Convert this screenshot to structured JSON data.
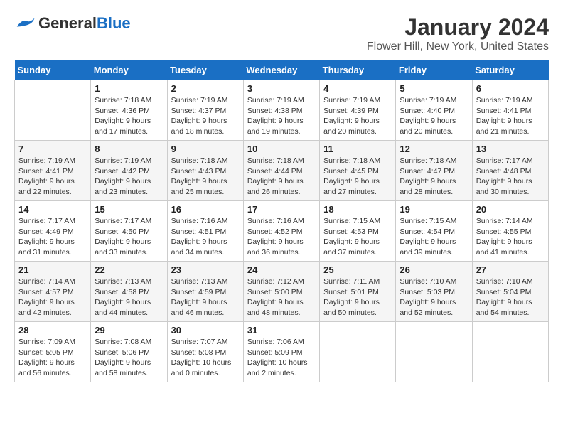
{
  "header": {
    "logo": {
      "general": "General",
      "blue": "Blue"
    },
    "title": "January 2024",
    "subtitle": "Flower Hill, New York, United States"
  },
  "calendar": {
    "days_of_week": [
      "Sunday",
      "Monday",
      "Tuesday",
      "Wednesday",
      "Thursday",
      "Friday",
      "Saturday"
    ],
    "weeks": [
      [
        {
          "day": "",
          "info": ""
        },
        {
          "day": "1",
          "info": "Sunrise: 7:18 AM\nSunset: 4:36 PM\nDaylight: 9 hours\nand 17 minutes."
        },
        {
          "day": "2",
          "info": "Sunrise: 7:19 AM\nSunset: 4:37 PM\nDaylight: 9 hours\nand 18 minutes."
        },
        {
          "day": "3",
          "info": "Sunrise: 7:19 AM\nSunset: 4:38 PM\nDaylight: 9 hours\nand 19 minutes."
        },
        {
          "day": "4",
          "info": "Sunrise: 7:19 AM\nSunset: 4:39 PM\nDaylight: 9 hours\nand 20 minutes."
        },
        {
          "day": "5",
          "info": "Sunrise: 7:19 AM\nSunset: 4:40 PM\nDaylight: 9 hours\nand 20 minutes."
        },
        {
          "day": "6",
          "info": "Sunrise: 7:19 AM\nSunset: 4:41 PM\nDaylight: 9 hours\nand 21 minutes."
        }
      ],
      [
        {
          "day": "7",
          "info": "Sunrise: 7:19 AM\nSunset: 4:41 PM\nDaylight: 9 hours\nand 22 minutes."
        },
        {
          "day": "8",
          "info": "Sunrise: 7:19 AM\nSunset: 4:42 PM\nDaylight: 9 hours\nand 23 minutes."
        },
        {
          "day": "9",
          "info": "Sunrise: 7:18 AM\nSunset: 4:43 PM\nDaylight: 9 hours\nand 25 minutes."
        },
        {
          "day": "10",
          "info": "Sunrise: 7:18 AM\nSunset: 4:44 PM\nDaylight: 9 hours\nand 26 minutes."
        },
        {
          "day": "11",
          "info": "Sunrise: 7:18 AM\nSunset: 4:45 PM\nDaylight: 9 hours\nand 27 minutes."
        },
        {
          "day": "12",
          "info": "Sunrise: 7:18 AM\nSunset: 4:47 PM\nDaylight: 9 hours\nand 28 minutes."
        },
        {
          "day": "13",
          "info": "Sunrise: 7:17 AM\nSunset: 4:48 PM\nDaylight: 9 hours\nand 30 minutes."
        }
      ],
      [
        {
          "day": "14",
          "info": "Sunrise: 7:17 AM\nSunset: 4:49 PM\nDaylight: 9 hours\nand 31 minutes."
        },
        {
          "day": "15",
          "info": "Sunrise: 7:17 AM\nSunset: 4:50 PM\nDaylight: 9 hours\nand 33 minutes."
        },
        {
          "day": "16",
          "info": "Sunrise: 7:16 AM\nSunset: 4:51 PM\nDaylight: 9 hours\nand 34 minutes."
        },
        {
          "day": "17",
          "info": "Sunrise: 7:16 AM\nSunset: 4:52 PM\nDaylight: 9 hours\nand 36 minutes."
        },
        {
          "day": "18",
          "info": "Sunrise: 7:15 AM\nSunset: 4:53 PM\nDaylight: 9 hours\nand 37 minutes."
        },
        {
          "day": "19",
          "info": "Sunrise: 7:15 AM\nSunset: 4:54 PM\nDaylight: 9 hours\nand 39 minutes."
        },
        {
          "day": "20",
          "info": "Sunrise: 7:14 AM\nSunset: 4:55 PM\nDaylight: 9 hours\nand 41 minutes."
        }
      ],
      [
        {
          "day": "21",
          "info": "Sunrise: 7:14 AM\nSunset: 4:57 PM\nDaylight: 9 hours\nand 42 minutes."
        },
        {
          "day": "22",
          "info": "Sunrise: 7:13 AM\nSunset: 4:58 PM\nDaylight: 9 hours\nand 44 minutes."
        },
        {
          "day": "23",
          "info": "Sunrise: 7:13 AM\nSunset: 4:59 PM\nDaylight: 9 hours\nand 46 minutes."
        },
        {
          "day": "24",
          "info": "Sunrise: 7:12 AM\nSunset: 5:00 PM\nDaylight: 9 hours\nand 48 minutes."
        },
        {
          "day": "25",
          "info": "Sunrise: 7:11 AM\nSunset: 5:01 PM\nDaylight: 9 hours\nand 50 minutes."
        },
        {
          "day": "26",
          "info": "Sunrise: 7:10 AM\nSunset: 5:03 PM\nDaylight: 9 hours\nand 52 minutes."
        },
        {
          "day": "27",
          "info": "Sunrise: 7:10 AM\nSunset: 5:04 PM\nDaylight: 9 hours\nand 54 minutes."
        }
      ],
      [
        {
          "day": "28",
          "info": "Sunrise: 7:09 AM\nSunset: 5:05 PM\nDaylight: 9 hours\nand 56 minutes."
        },
        {
          "day": "29",
          "info": "Sunrise: 7:08 AM\nSunset: 5:06 PM\nDaylight: 9 hours\nand 58 minutes."
        },
        {
          "day": "30",
          "info": "Sunrise: 7:07 AM\nSunset: 5:08 PM\nDaylight: 10 hours\nand 0 minutes."
        },
        {
          "day": "31",
          "info": "Sunrise: 7:06 AM\nSunset: 5:09 PM\nDaylight: 10 hours\nand 2 minutes."
        },
        {
          "day": "",
          "info": ""
        },
        {
          "day": "",
          "info": ""
        },
        {
          "day": "",
          "info": ""
        }
      ]
    ]
  }
}
